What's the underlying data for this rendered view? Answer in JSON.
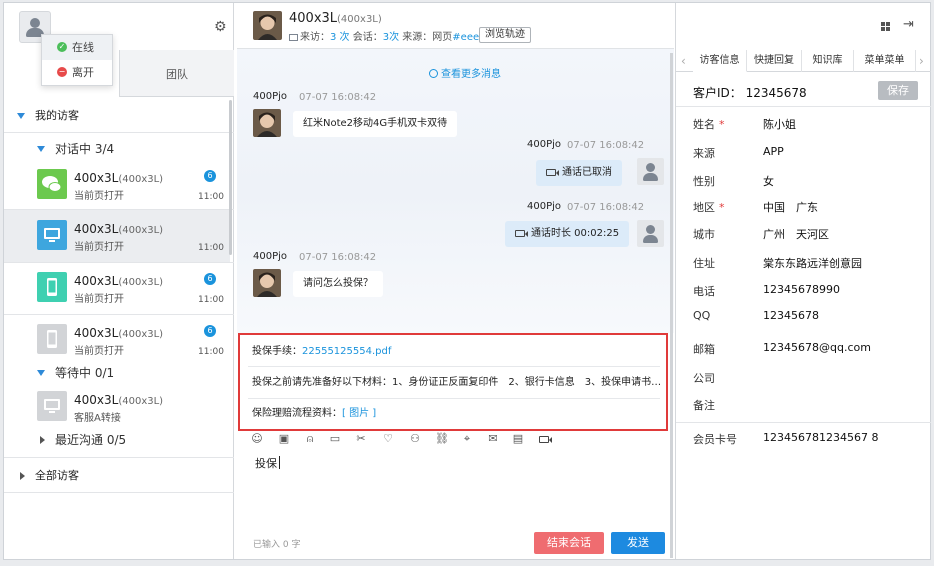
{
  "status_menu": {
    "online": "在线",
    "away": "离开"
  },
  "left_tabs": {
    "team": "团队"
  },
  "my_visitors": "我的访客",
  "in_chat": "对话中 3/4",
  "waiting": "等待中 0/1",
  "recent": "最近沟通 0/5",
  "all_visitors": "全部访客",
  "visitors": [
    {
      "name": "400x3L",
      "alias": "(400x3L)",
      "sub": "当前页打开",
      "badge": "6",
      "time": "11:00",
      "icon": "wechat-icon",
      "color": "#6cc94e"
    },
    {
      "name": "400x3L",
      "alias": "(400x3L)",
      "sub": "当前页打开",
      "badge": "",
      "time": "11:00",
      "icon": "desktop-icon",
      "color": "#3ea6de"
    },
    {
      "name": "400x3L",
      "alias": "(400x3L)",
      "sub": "当前页打开",
      "badge": "6",
      "time": "11:00",
      "icon": "phone-icon",
      "color": "#3fd0b1"
    },
    {
      "name": "400x3L",
      "alias": "(400x3L)",
      "sub": "当前页打开",
      "badge": "6",
      "time": "11:00",
      "icon": "phone-icon",
      "color": "#c9cbce"
    }
  ],
  "waiting_visitor": {
    "name": "400x3L",
    "alias": "(400x3L)",
    "sub": "客服A转接",
    "icon": "desktop-icon",
    "color": "#c9cbce"
  },
  "chat": {
    "name": "400x3L",
    "alias": "(400x3L)",
    "meta_visits_label": "来访：",
    "meta_visits": "3 次",
    "meta_sessions_label": "会话：",
    "meta_sessions": "3次",
    "meta_source_label": "来源：网页",
    "meta_source": "#eee",
    "trail_button": "浏览轨迹",
    "load_more": "查看更多消息"
  },
  "messages": [
    {
      "sender": "400Pjo",
      "time": "07-07 16:08:42",
      "text": "红米Note2移动4G手机双卡双待"
    },
    {
      "sender": "400Pjo",
      "time": "07-07 16:08:42",
      "text": "通话已取消"
    },
    {
      "sender": "400Pjo",
      "time": "07-07 16:08:42",
      "text": "通话时长 00:02:25"
    },
    {
      "sender": "400Pjo",
      "time": "07-07 16:08:42",
      "text": "请问怎么投保？"
    }
  ],
  "quick_replies": [
    {
      "label": "投保手续：",
      "link": "22555125554.pdf"
    },
    {
      "label": "投保之前请先准备好以下材料：1、身份证正反面复印件　2、银行卡信息　3、投保申请书…",
      "link": ""
    },
    {
      "label": "保险理赔流程资料：",
      "link": "[ 图片 ]"
    }
  ],
  "input_text": "投保",
  "input_count": "已输入 0 字",
  "buttons": {
    "end": "结束会话",
    "send": "发送"
  },
  "right_tabs": [
    "访客信息",
    "快捷回复",
    "知识库",
    "菜单菜单"
  ],
  "customer_id": "客户ID： 12345678",
  "save": "保存",
  "fields": [
    {
      "label": "姓名",
      "value": "陈小姐",
      "required": true
    },
    {
      "label": "来源",
      "value": "APP",
      "required": false
    },
    {
      "label": "性别",
      "value": "女",
      "required": false
    },
    {
      "label": "地区",
      "value": "中国　广东",
      "required": true
    },
    {
      "label": "城市",
      "value": "广州　天河区",
      "required": false
    },
    {
      "label": "住址",
      "value": "棠东东路远洋创意园",
      "required": false
    },
    {
      "label": "电话",
      "value": "12345678990",
      "required": false
    },
    {
      "label": "QQ",
      "value": "12345678",
      "required": false
    },
    {
      "label": "邮箱",
      "value": "12345678@qq.com",
      "required": false
    },
    {
      "label": "公司",
      "value": "",
      "required": false
    },
    {
      "label": "备注",
      "value": "",
      "required": false
    },
    {
      "label": "会员卡号",
      "value": "123456781234567 8",
      "required": false
    }
  ]
}
